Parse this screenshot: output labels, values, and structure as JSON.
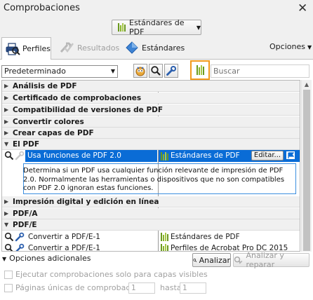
{
  "window": {
    "title": "Comprobaciones",
    "close_label": "✕"
  },
  "standards_menu": {
    "label": "Estándares de PDF"
  },
  "tabs": [
    {
      "label": "Perfiles",
      "selected": true
    },
    {
      "label": "Resultados",
      "selected": false,
      "disabled": true
    },
    {
      "label": "Estándares",
      "selected": false
    }
  ],
  "options_menu": {
    "label": "Opciones"
  },
  "profile_select": {
    "value": "Predeterminado"
  },
  "search": {
    "placeholder": "Buscar"
  },
  "groups": [
    {
      "label": "Análisis de PDF",
      "expanded": false
    },
    {
      "label": "Certificado de comprobaciones",
      "expanded": false
    },
    {
      "label": "Compatibilidad de versiones de PDF",
      "expanded": false
    },
    {
      "label": "Convertir colores",
      "expanded": false
    },
    {
      "label": "Crear capas de PDF",
      "expanded": false
    },
    {
      "label": "El PDF",
      "expanded": true
    },
    {
      "label": "Impresión digital y edición en línea",
      "expanded": false
    },
    {
      "label": "PDF/A",
      "expanded": false
    },
    {
      "label": "PDF/E",
      "expanded": true
    }
  ],
  "selected_fixup": {
    "name": "Usa funciones de PDF 2.0",
    "standard": "Estándares de PDF",
    "edit_label": "Editar...",
    "description": "Determina si un PDF usa cualquier función relevante de impresión de PDF 2.0. Normalmente las herramientas o dispositivos que no son compatibles con PDF 2.0 ignoran estas funciones."
  },
  "pdfe_items": [
    {
      "name": "Convertir a PDF/E-1",
      "library": "Estándares de PDF"
    },
    {
      "name": "Convertir a PDF/E-1",
      "library": "Perfiles de Acrobat Pro DC 2015"
    }
  ],
  "additional_options": {
    "label": "Opciones adicionales"
  },
  "buttons": {
    "analyze": "Analizar",
    "analyze_fix": "Analizar y reparar"
  },
  "options": {
    "visible_layers_only": "Ejecutar comprobaciones solo para capas visibles",
    "page_range_label": "Páginas únicas de comprobaciones",
    "page_from": "1",
    "page_to_label": "hasta",
    "page_to": "1"
  },
  "colors": {
    "selection": "#0a6cd6",
    "highlight": "#f29a1b",
    "standards_green": "#6b9a1f"
  }
}
